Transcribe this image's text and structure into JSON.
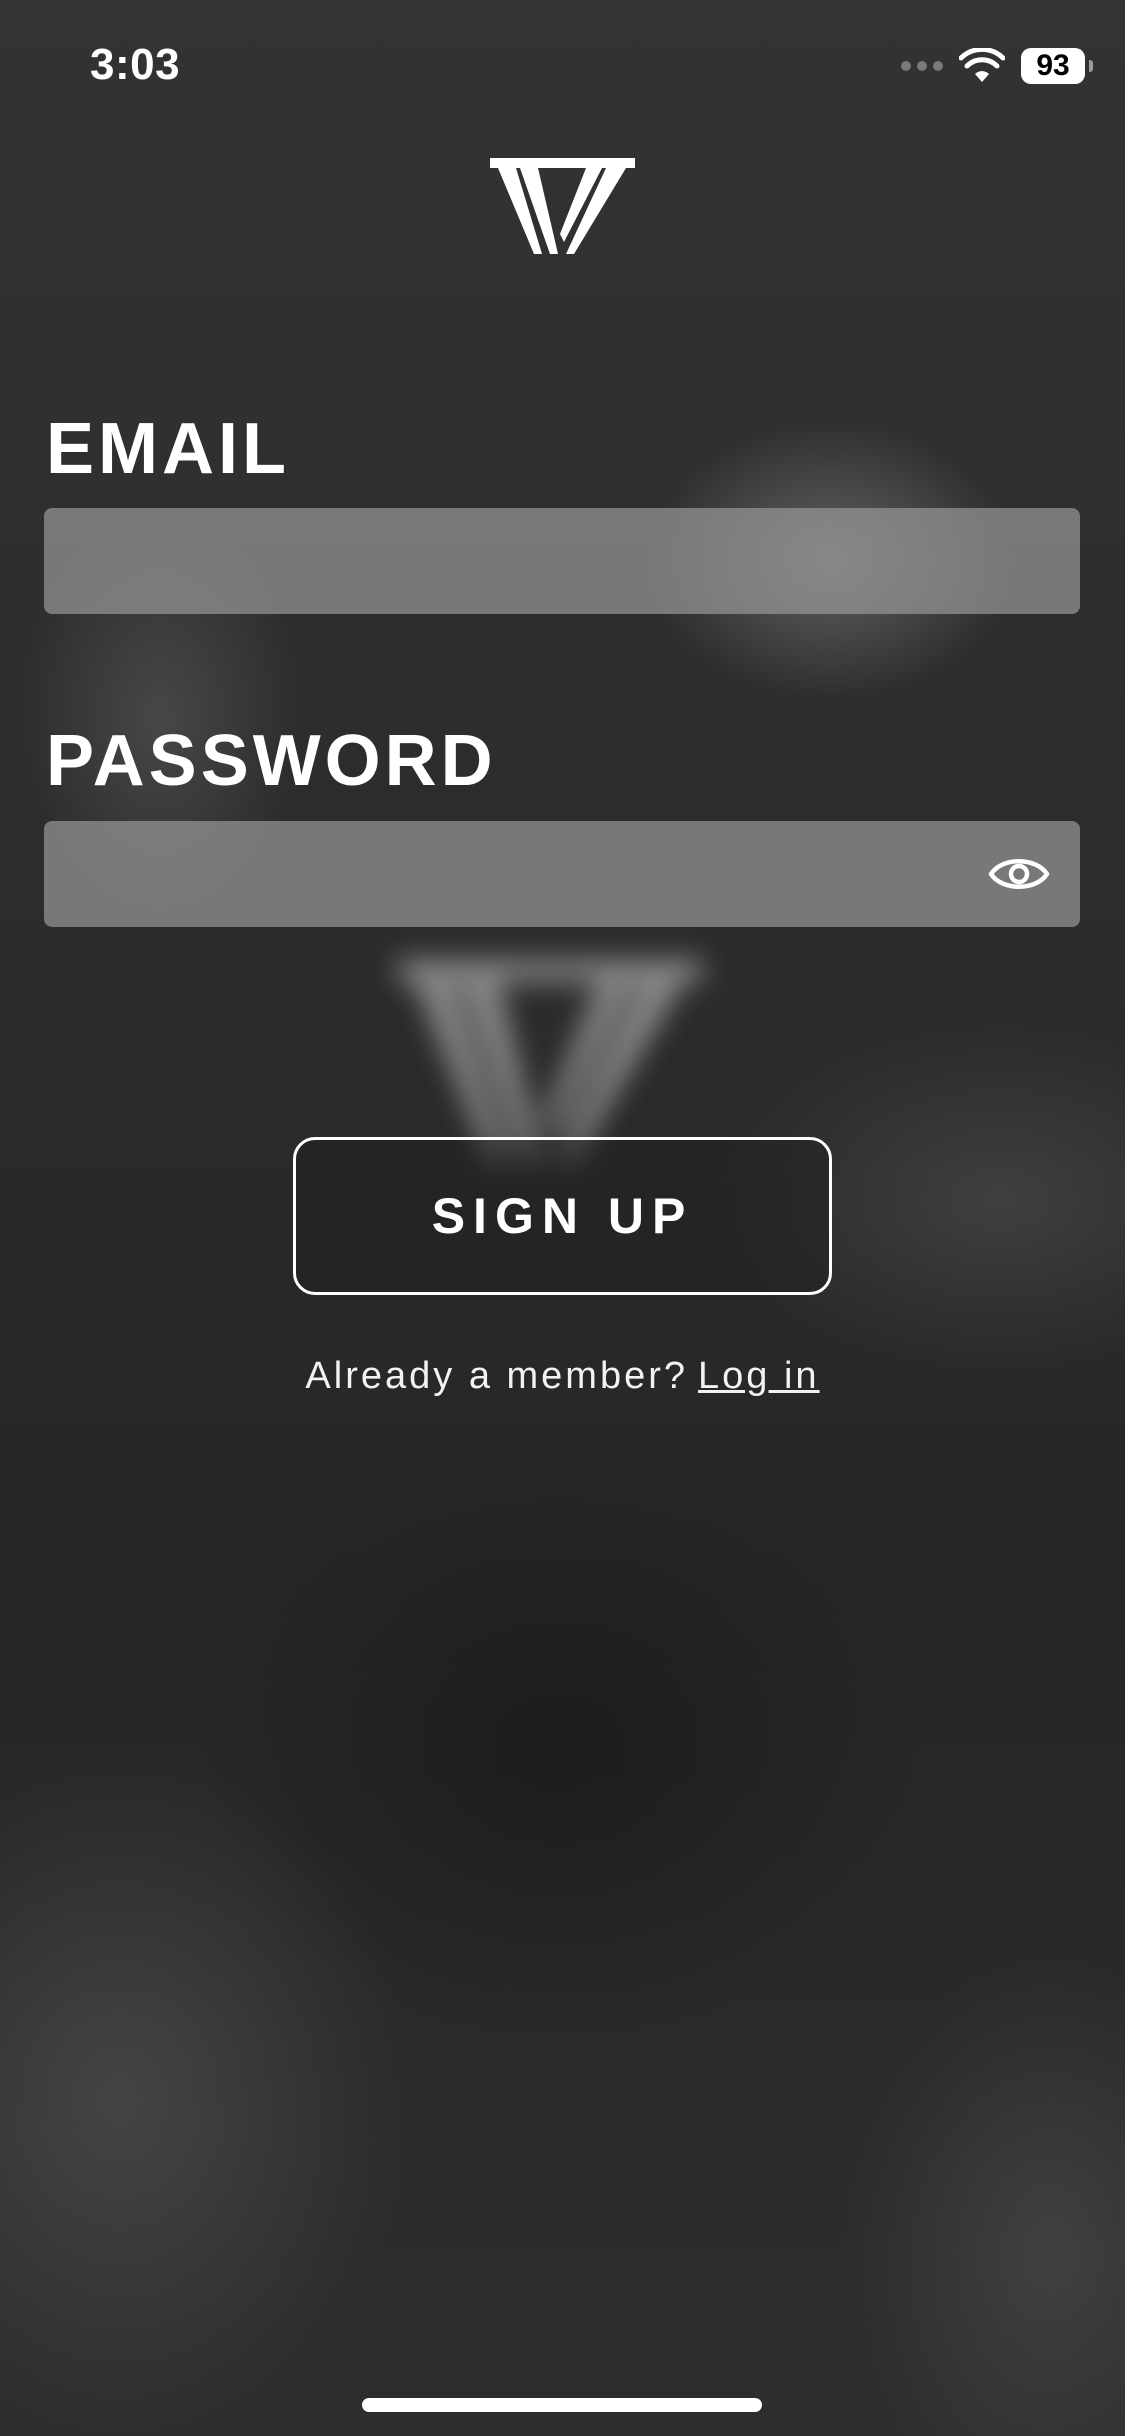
{
  "status_bar": {
    "time": "3:03",
    "battery_percent": "93",
    "icons": [
      "cellular-signal-icon",
      "wifi-icon",
      "battery-icon"
    ]
  },
  "brand": {
    "logo_icon": "brand-logo-icon"
  },
  "form": {
    "email_label": "EMAIL",
    "email_value": "",
    "password_label": "PASSWORD",
    "password_value": "",
    "password_toggle_icon": "eye-icon",
    "signup_label": "SIGN UP"
  },
  "footer": {
    "member_prompt": "Already a member?",
    "login_link": "Log in"
  },
  "colors": {
    "background": "#2a2a2a",
    "field_background": "#969696",
    "text": "#ffffff"
  }
}
